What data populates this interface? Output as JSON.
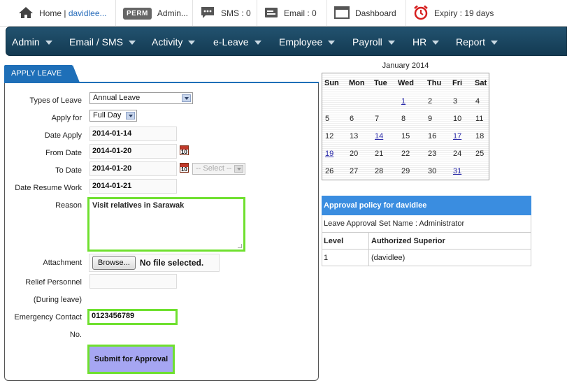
{
  "topbar": {
    "home_label": "Home |",
    "username": "davidlee...",
    "perm_badge": "PERM",
    "admin_label": "Admin...",
    "sms_label": "SMS : 0",
    "email_label": "Email : 0",
    "dashboard_label": "Dashboard",
    "expiry_label": "Expiry : 19 days"
  },
  "nav": {
    "items": [
      "Admin",
      "Email / SMS",
      "Activity",
      "e-Leave",
      "Employee",
      "Payroll",
      "HR",
      "Report"
    ]
  },
  "form": {
    "tab_label": "APPLY LEAVE",
    "types_of_leave_label": "Types of Leave",
    "types_of_leave_value": "Annual Leave",
    "apply_for_label": "Apply for",
    "apply_for_value": "Full Day",
    "date_apply_label": "Date Apply",
    "date_apply_value": "2014-01-14",
    "from_date_label": "From Date",
    "from_date_value": "2014-01-20",
    "to_date_label": "To Date",
    "to_date_value": "2014-01-20",
    "half_day_select": "-- Select --",
    "resume_label": "Date Resume Work",
    "resume_value": "2014-01-21",
    "reason_label": "Reason",
    "reason_value": "Visit relatives in Sarawak",
    "attachment_label": "Attachment",
    "browse_label": "Browse...",
    "no_file_label": "No file selected.",
    "relief_label": "Relief Personnel",
    "relief_sub_label": "(During leave)",
    "relief_value": "",
    "emergency_label": "Emergency Contact",
    "emergency_sub_label": "No.",
    "emergency_value": "0123456789",
    "calendar_icon_text": "10",
    "submit_label": "Submit for Approval"
  },
  "calendar": {
    "title": "January 2014",
    "headers": [
      "Sun",
      "Mon",
      "Tue",
      "Wed",
      "Thu",
      "Fri",
      "Sat"
    ],
    "weeks": [
      [
        "",
        "",
        "",
        "1",
        "2",
        "3",
        "4"
      ],
      [
        "5",
        "6",
        "7",
        "8",
        "9",
        "10",
        "11"
      ],
      [
        "12",
        "13",
        "14",
        "15",
        "16",
        "17",
        "18"
      ],
      [
        "19",
        "20",
        "21",
        "22",
        "23",
        "24",
        "25"
      ],
      [
        "26",
        "27",
        "28",
        "29",
        "30",
        "31",
        ""
      ]
    ],
    "linked_days": [
      "1",
      "14",
      "17",
      "19",
      "31"
    ]
  },
  "approval": {
    "header": "Approval policy for davidlee",
    "set_name": "Leave Approval Set Name : Administrator",
    "col_level": "Level",
    "col_superior": "Authorized Superior",
    "rows": [
      {
        "level": "1",
        "superior": "(davidlee)"
      }
    ]
  },
  "colors": {
    "nav_bg": "#1b4663",
    "tab_blue": "#1e6fb8",
    "highlight_green": "#6fe02f",
    "submit_bg": "#a6a6f2",
    "approval_header": "#3a8de0"
  }
}
